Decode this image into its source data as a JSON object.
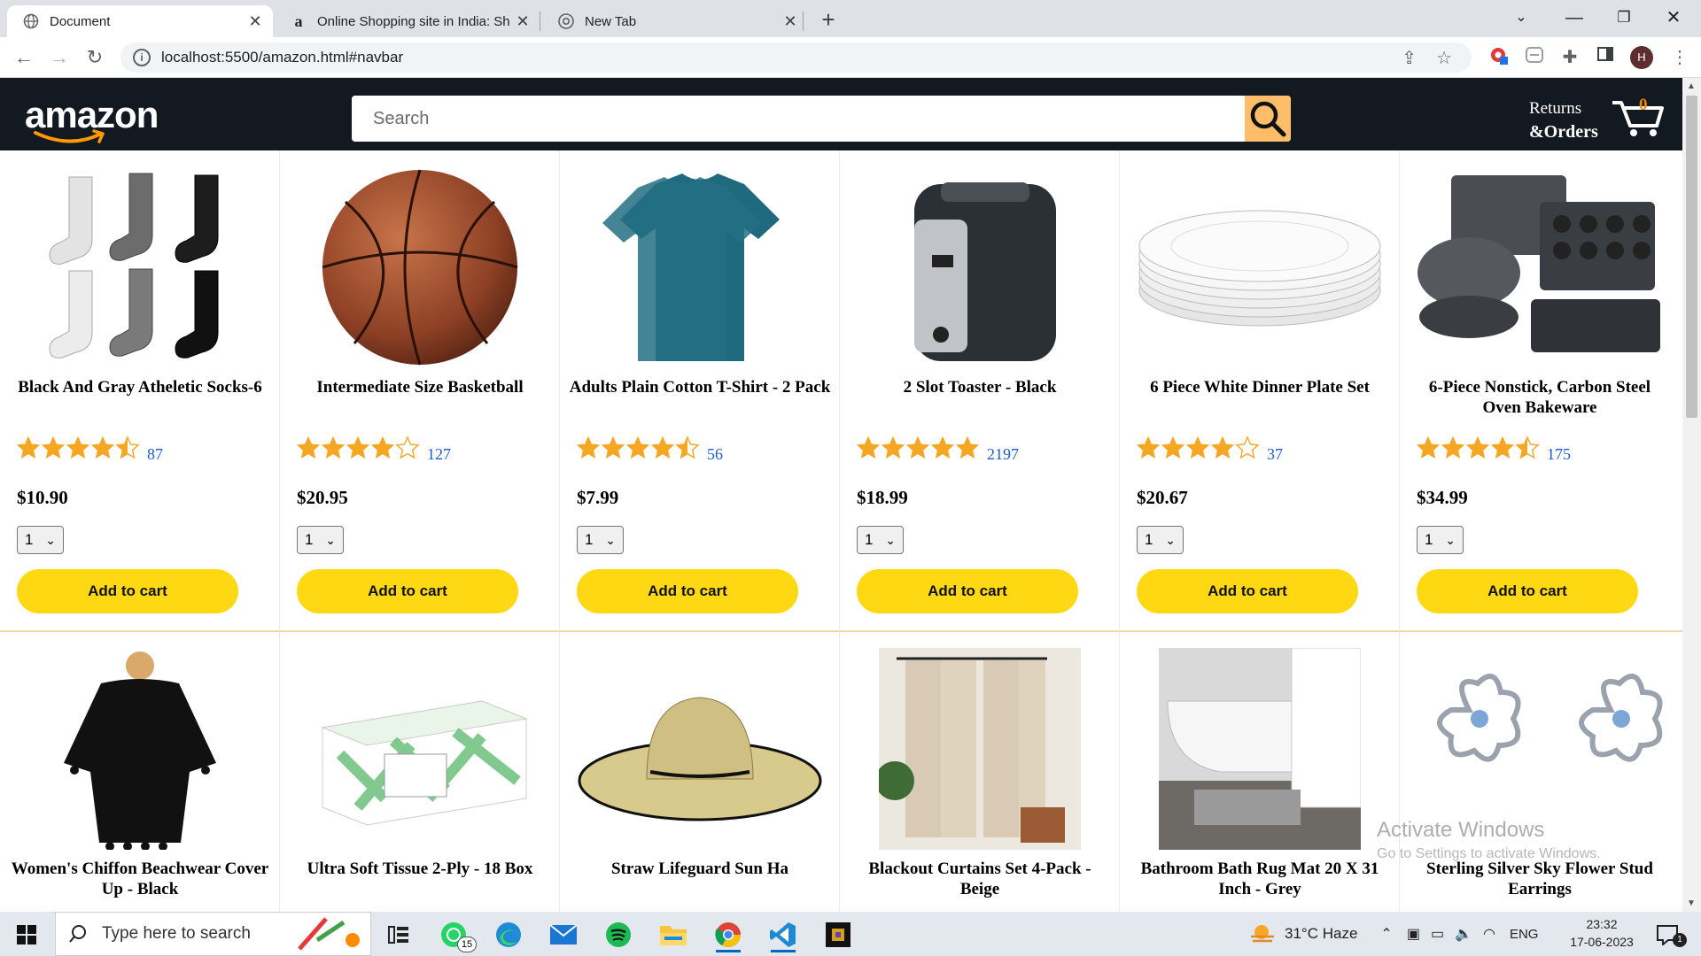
{
  "browser": {
    "tabs": [
      {
        "title": "Document",
        "favicon": "globe-icon"
      },
      {
        "title": "Online Shopping site in India: Sh",
        "favicon": "amazon-a-icon"
      },
      {
        "title": "New Tab",
        "favicon": "chrome-icon"
      }
    ],
    "url": "localhost:5500/amazon.html#navbar",
    "profile_initial": "H"
  },
  "navbar": {
    "logo_text": "amazon",
    "search_placeholder": "Search",
    "returns_line1": "Returns",
    "returns_line2": "&Orders",
    "cart_count": "0"
  },
  "products": [
    {
      "name": "Black And Gray Atheletic Socks-6",
      "stars": 4.5,
      "count": "87",
      "price": "$10.90",
      "qty": "1",
      "image": "socks-image"
    },
    {
      "name": "Intermediate Size Basketball",
      "stars": 4.0,
      "count": "127",
      "price": "$20.95",
      "qty": "1",
      "image": "basketball-image"
    },
    {
      "name": "Adults Plain Cotton T-Shirt - 2 Pack",
      "stars": 4.5,
      "count": "56",
      "price": "$7.99",
      "qty": "1",
      "image": "tshirt-image"
    },
    {
      "name": "2 Slot Toaster - Black",
      "stars": 5.0,
      "count": "2197",
      "price": "$18.99",
      "qty": "1",
      "image": "toaster-image"
    },
    {
      "name": "6 Piece White Dinner Plate Set",
      "stars": 4.0,
      "count": "37",
      "price": "$20.67",
      "qty": "1",
      "image": "plates-image"
    },
    {
      "name": "6-Piece Nonstick, Carbon Steel Oven Bakeware",
      "stars": 4.5,
      "count": "175",
      "price": "$34.99",
      "qty": "1",
      "image": "bakeware-image"
    },
    {
      "name": "Women's Chiffon Beachwear Cover Up - Black",
      "image": "beachwear-image"
    },
    {
      "name": "Ultra Soft Tissue 2-Ply - 18 Box",
      "image": "tissue-image"
    },
    {
      "name": "Straw Lifeguard Sun Ha",
      "image": "sun-hat-image"
    },
    {
      "name": "Blackout Curtains Set 4-Pack - Beige",
      "image": "curtains-image"
    },
    {
      "name": "Bathroom Bath Rug Mat 20 X 31 Inch - Grey",
      "image": "bath-rug-image"
    },
    {
      "name": "Sterling Silver Sky Flower Stud Earrings",
      "image": "earrings-image"
    }
  ],
  "add_to_cart_label": "Add to cart",
  "watermark": {
    "line1": "Activate Windows",
    "line2": "Go to Settings to activate Windows."
  },
  "taskbar": {
    "search_placeholder": "Type here to search",
    "whatsapp_badge": "15",
    "weather": "31°C  Haze",
    "language": "ENG",
    "time": "23:32",
    "date": "17-06-2023",
    "notification_count": "1"
  },
  "colors": {
    "navbar_bg": "#131921",
    "search_btn": "#febd69",
    "add_btn": "#ffd814",
    "star": "#f5a623",
    "link": "#1f5cc7"
  }
}
